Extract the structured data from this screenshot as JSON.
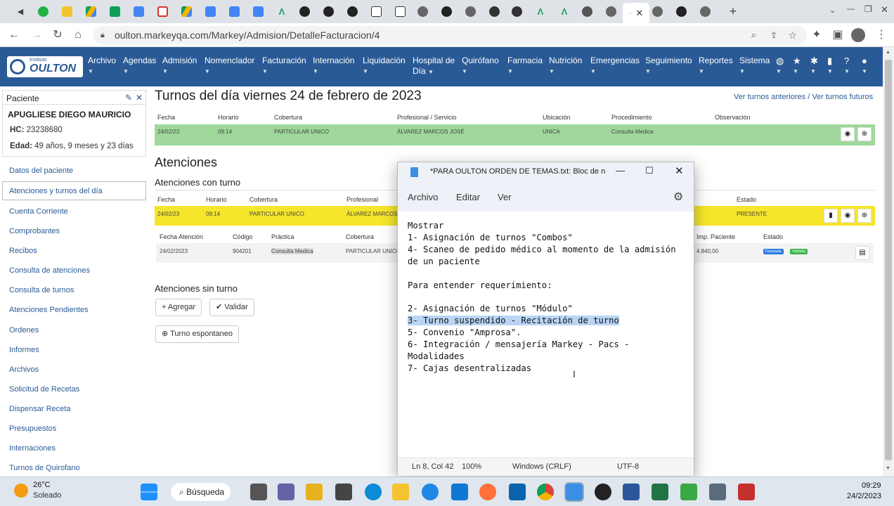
{
  "browser": {
    "url": "oulton.markeyqa.com/Markey/Admision/DetalleFacturacion/4"
  },
  "app": {
    "logo_small": "Instituto",
    "logo_name": "OULTON",
    "menu": [
      "Archivo",
      "Agendas",
      "Admisión",
      "Nomenclador",
      "Facturación",
      "Internación",
      "Liquidación",
      "Hospital de",
      "Quirófano",
      "Farmacia",
      "Nutrición",
      "Emergencias",
      "Seguimiento",
      "Reportes",
      "Sistema"
    ],
    "menu_hospital_second": "Día"
  },
  "patient": {
    "header": "Paciente",
    "name": "APUGLIESE DIEGO MAURICIO",
    "hc_label": "HC:",
    "hc": "23238680",
    "age_label": "Edad:",
    "age": "49 años, 9 meses y 23 días"
  },
  "sidebar": [
    "Datos del paciente",
    "Atenciones y turnos del día",
    "Cuenta Corriente",
    "Comprobantes",
    "Recibos",
    "Consulta de atenciones",
    "Consulta de turnos",
    "Atenciones Pendientes",
    "Ordenes",
    "Informes",
    "Archivos",
    "Solicitud de Recetas",
    "Dispensar Receta",
    "Presupuestos",
    "Internaciones",
    "Turnos de Quirofano"
  ],
  "main": {
    "title": "Turnos del día viernes 24 de febrero de 2023",
    "link_prev": "Ver turnos anteriores",
    "sep": "/",
    "link_next": "Ver turnos futuros",
    "turnos_headers": [
      "Fecha",
      "Horario",
      "Cobertura",
      "Profesional / Servicio",
      "Ubicación",
      "Procedimiento",
      "Observación"
    ],
    "turnos_row": [
      "24/02/23",
      "09:14",
      "PARTICULAR UNICO",
      "ÁLVAREZ MARCOS JOSÉ",
      "UNICA",
      "Consulta Medica",
      ""
    ],
    "atenciones_title": "Atenciones",
    "con_turno": "Atenciones con turno",
    "at_headers": [
      "Fecha",
      "Horario",
      "Cobertura",
      "Profesional"
    ],
    "at_estado_header": "Estado",
    "at_row": [
      "24/02/23",
      "09:14",
      "PARTICULAR UNICO",
      "ÁLVAREZ MARCOS"
    ],
    "at_estado": "PRESENTE",
    "pr_headers": [
      "Fecha Atención",
      "Código",
      "Práctica",
      "Cobertura"
    ],
    "pr_imp_header": "Imp. Paciente",
    "pr_estado_header": "Estado",
    "pr_row": [
      "24/02/2023",
      "904201",
      "Consulta Medica",
      "PARTICULAR UNICO"
    ],
    "pr_imp": "4.840,00",
    "badge1": "Facturada",
    "badge2": "Validada",
    "sin_turno": "Atenciones sin turno",
    "btn_add": "Agregar",
    "btn_validate": "Validar",
    "btn_spont": "Turno espontaneo"
  },
  "notepad": {
    "title": "*PARA OULTON ORDEN DE TEMAS.txt: Bloc de n...",
    "menu": [
      "Archivo",
      "Editar",
      "Ver"
    ],
    "lines_before": "Mostrar\n1- Asignación de turnos \"Combos\"\n4- Scaneo de pedido médico al momento de la admisión\nde un paciente\n\nPara entender requerimiento:\n\n2- Asignación de turnos \"Módulo\"",
    "highlight": "3- Turno suspendido - Recitación de turno",
    "lines_after": "5- Convenio \"Amprosa\".\n6- Integración / mensajería Markey - Pacs -\nModalidades\n7- Cajas desentralizadas",
    "status": {
      "pos": "Ln 8, Col 42",
      "zoom": "100%",
      "eol": "Windows (CRLF)",
      "enc": "UTF-8"
    }
  },
  "taskbar": {
    "temp": "26°C",
    "weather": "Soleado",
    "search": "Búsqueda",
    "time": "09:29",
    "date": "24/2/2023"
  }
}
